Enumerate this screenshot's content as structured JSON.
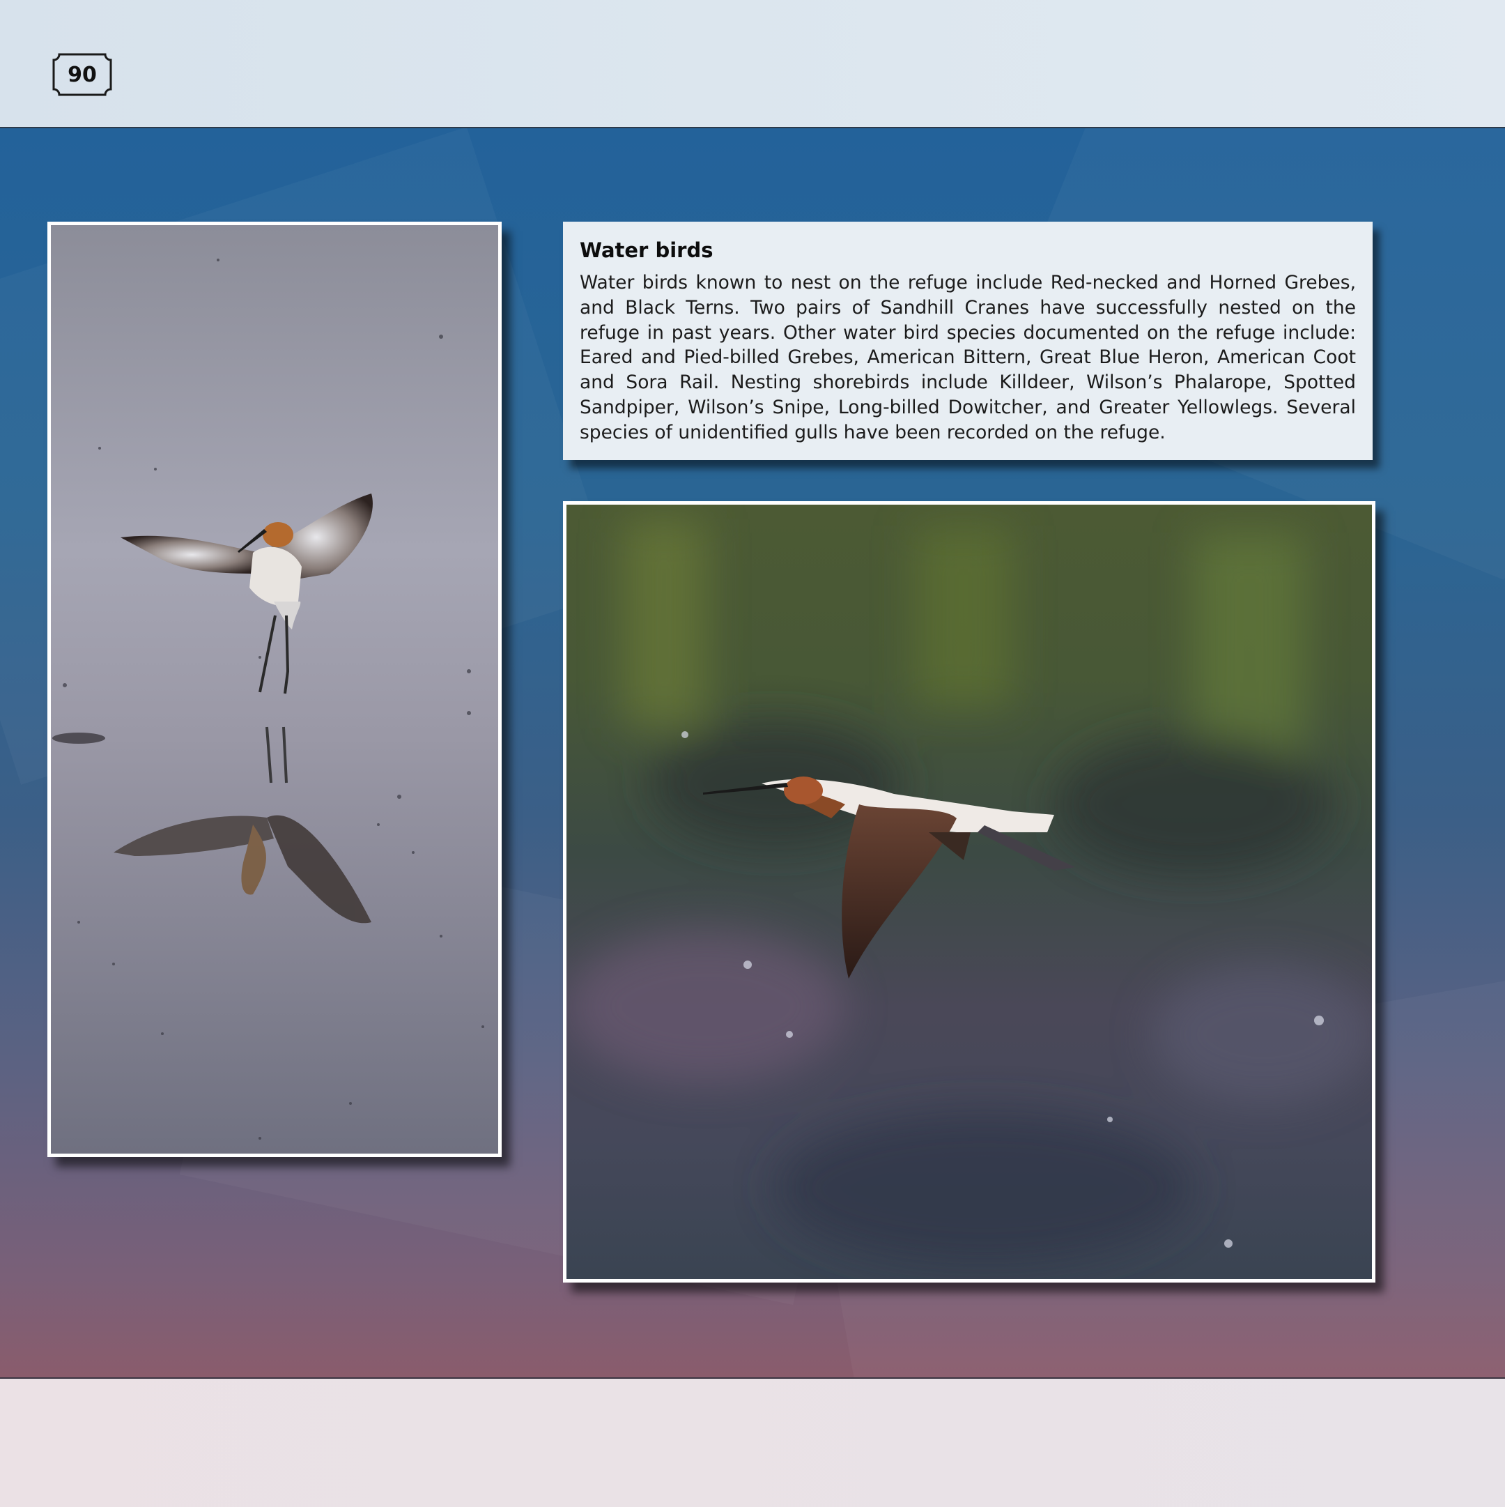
{
  "page": {
    "number": "90"
  },
  "article": {
    "title": "Water birds",
    "body": "Water birds known to nest on the refuge include Red-necked and Horned Grebes, and Black Terns. Two pairs of Sandhill Cranes have successfully nested on the refuge in past years. Other water bird species documented on the refuge include: Eared and Pied-billed Grebes, American Bittern, Great Blue Heron, American Coot and Sora Rail. Nesting shorebirds include Killdeer, Wilson’s Phalarope, Spotted Sandpiper, Wilson’s Snipe, Long-billed Dowitcher, and Greater Yellowlegs. Several species of unidentified gulls have been recorded on the refuge."
  },
  "colors": {
    "band_top": "#23629a",
    "band_bottom": "#8a5c6c",
    "text_box_bg": "#e8eef3",
    "photo_border": "#ffffff"
  }
}
